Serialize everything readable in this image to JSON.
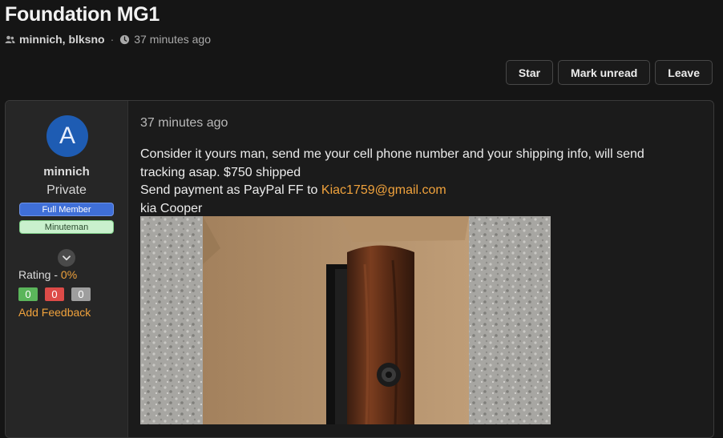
{
  "thread": {
    "title": "Foundation MG1",
    "participants": "minnich, blksno",
    "time": "37 minutes ago"
  },
  "actions": {
    "star": "Star",
    "mark_unread": "Mark unread",
    "leave": "Leave"
  },
  "post": {
    "author": {
      "avatar_letter": "A",
      "name": "minnich",
      "status": "Private",
      "badges": [
        "Full Member",
        "Minuteman"
      ],
      "rating_label": "Rating - ",
      "rating_value": "0%",
      "counts": {
        "positive": "0",
        "negative": "0",
        "neutral": "0"
      },
      "feedback_link": "Add Feedback"
    },
    "time": "37 minutes ago",
    "lines": [
      "Consider it yours man, send me your cell phone number and your shipping info, will send tracking asap. $750 shipped",
      "Send payment as PayPal FF to ",
      "kia Cooper"
    ],
    "email": "Kiac1759@gmail.com"
  },
  "colors": {
    "accent": "#f0a23c",
    "avatar": "#1e5cb3",
    "badge_full": "#3f6fd8",
    "badge_minuteman": "#c9f0cd"
  },
  "icons": {
    "participants": "users-icon",
    "time": "clock-icon",
    "expand": "chevron-down-icon"
  }
}
